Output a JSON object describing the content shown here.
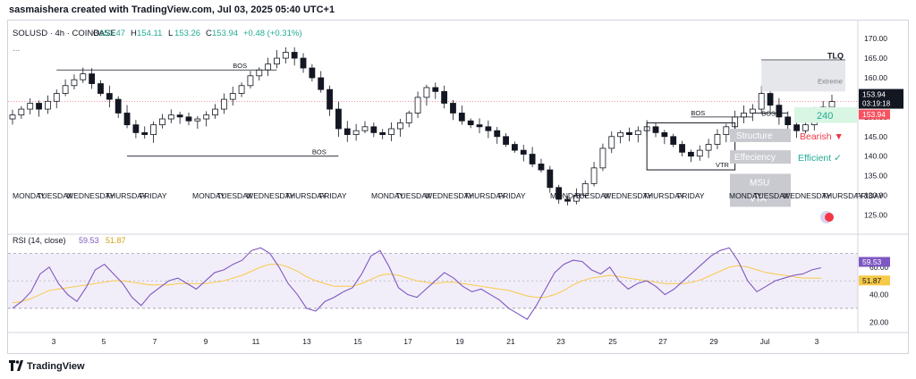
{
  "header": {
    "text": "sasmaishera created with TradingView.com, Jul 03, 2025 05:40 UTC+1"
  },
  "footer": {
    "brand": "TradingView"
  },
  "chart_data": [
    {
      "type": "candlestick",
      "symbol": "SOLUSD",
      "interval": "4h",
      "exchange": "COINBASE",
      "ohlc_labels": {
        "o": "O",
        "h": "H",
        "l": "L",
        "c": "C"
      },
      "ohlc": {
        "open": "153.47",
        "high": "154.11",
        "low": "153.26",
        "close": "153.94",
        "change": "+0.48 (+0.31%)"
      },
      "y_ticks": [
        170,
        165,
        160,
        155,
        150,
        145,
        140,
        135,
        130,
        125
      ],
      "ylim": [
        121,
        173
      ],
      "last_price": "153.94",
      "countdown": "03:19:18",
      "price_badge_2": "153.94",
      "x_ticks": [
        "3",
        "5",
        "7",
        "9",
        "11",
        "13",
        "15",
        "17",
        "19",
        "21",
        "23",
        "25",
        "27",
        "29",
        "Jul",
        "3"
      ],
      "close_path": [
        [
          0,
          150.5
        ],
        [
          1,
          152.0
        ],
        [
          2,
          153.5
        ],
        [
          3,
          152.0
        ],
        [
          4,
          154.0
        ],
        [
          5,
          156.0
        ],
        [
          6,
          158.0
        ],
        [
          7,
          159.5
        ],
        [
          8,
          161.0
        ],
        [
          9,
          158.5
        ],
        [
          10,
          156.0
        ],
        [
          11,
          154.5
        ],
        [
          12,
          151.0
        ],
        [
          13,
          148.0
        ],
        [
          14,
          146.0
        ],
        [
          15,
          145.5
        ],
        [
          16,
          148.0
        ],
        [
          17,
          149.5
        ],
        [
          18,
          150.5
        ],
        [
          19,
          150.0
        ],
        [
          20,
          149.0
        ],
        [
          21,
          149.5
        ],
        [
          22,
          150.5
        ],
        [
          23,
          152.0
        ],
        [
          24,
          154.5
        ],
        [
          25,
          156.0
        ],
        [
          26,
          158.0
        ],
        [
          27,
          160.5
        ],
        [
          28,
          162.0
        ],
        [
          29,
          163.5
        ],
        [
          30,
          165.0
        ],
        [
          31,
          166.5
        ],
        [
          32,
          165.0
        ],
        [
          33,
          162.5
        ],
        [
          34,
          160.0
        ],
        [
          35,
          157.0
        ],
        [
          36,
          152.0
        ],
        [
          37,
          147.0
        ],
        [
          38,
          145.5
        ],
        [
          39,
          146.5
        ],
        [
          40,
          147.5
        ],
        [
          41,
          146.0
        ],
        [
          42,
          145.5
        ],
        [
          43,
          147.0
        ],
        [
          44,
          148.5
        ],
        [
          45,
          151.0
        ],
        [
          46,
          155.0
        ],
        [
          47,
          157.5
        ],
        [
          48,
          156.5
        ],
        [
          49,
          153.5
        ],
        [
          50,
          151.0
        ],
        [
          51,
          149.0
        ],
        [
          52,
          148.0
        ],
        [
          53,
          147.5
        ],
        [
          54,
          146.5
        ],
        [
          55,
          145.0
        ],
        [
          56,
          143.0
        ],
        [
          57,
          141.5
        ],
        [
          58,
          140.5
        ],
        [
          59,
          138.0
        ],
        [
          60,
          136.5
        ],
        [
          61,
          132.0
        ],
        [
          62,
          129.0
        ],
        [
          63,
          128.5
        ],
        [
          64,
          130.0
        ],
        [
          65,
          133.0
        ],
        [
          66,
          137.0
        ],
        [
          67,
          142.0
        ],
        [
          68,
          145.0
        ],
        [
          69,
          146.0
        ],
        [
          70,
          145.5
        ],
        [
          71,
          146.5
        ],
        [
          72,
          147.5
        ],
        [
          73,
          146.0
        ],
        [
          74,
          145.0
        ],
        [
          75,
          143.0
        ],
        [
          76,
          141.0
        ],
        [
          77,
          140.0
        ],
        [
          78,
          141.5
        ],
        [
          79,
          143.0
        ],
        [
          80,
          145.5
        ],
        [
          81,
          147.5
        ],
        [
          82,
          150.0
        ],
        [
          83,
          151.0
        ],
        [
          84,
          152.0
        ],
        [
          85,
          156.0
        ],
        [
          86,
          153.0
        ],
        [
          87,
          150.0
        ],
        [
          88,
          148.0
        ],
        [
          89,
          146.5
        ],
        [
          90,
          148.0
        ],
        [
          91,
          150.5
        ],
        [
          92,
          152.5
        ],
        [
          93,
          153.94
        ]
      ],
      "annotations": {
        "bos_labels": [
          "BOS",
          "BOS",
          "BOS",
          "BOS"
        ],
        "vtr": "VTR",
        "tlq": "TLQ",
        "extreme": "Extreme",
        "price_240": "240",
        "structure": "Structure",
        "efficiency": "Effeciency",
        "msu": "MSU",
        "vta": "VTA",
        "bearish": "Bearish ▼",
        "efficient": "Efficient ✓",
        "bearish_color": "#f23645",
        "efficient_color": "#22ab94",
        "dots": "..."
      },
      "weekday_labels": [
        "MONDAY",
        "TUESDAY",
        "WEDNESDAY",
        "THURSDAY",
        "FRIDAY"
      ]
    },
    {
      "type": "line",
      "title": "RSI (14, close)",
      "series": [
        {
          "name": "RSI",
          "value_label": "59.53",
          "color": "#7e57c2"
        },
        {
          "name": "RSI MA",
          "value_label": "51.87",
          "color": "#f7c948"
        }
      ],
      "y_ticks": [
        60,
        40,
        20
      ],
      "band": [
        30,
        70
      ],
      "ylim": [
        15,
        80
      ],
      "rsi_values": [
        30,
        35,
        42,
        55,
        60,
        48,
        40,
        35,
        45,
        58,
        62,
        55,
        48,
        38,
        32,
        40,
        45,
        50,
        52,
        48,
        44,
        50,
        56,
        58,
        62,
        65,
        72,
        74,
        70,
        60,
        48,
        40,
        30,
        28,
        35,
        38,
        42,
        45,
        55,
        68,
        72,
        60,
        45,
        40,
        38,
        44,
        50,
        56,
        52,
        46,
        42,
        44,
        40,
        36,
        30,
        26,
        22,
        32,
        44,
        56,
        62,
        65,
        64,
        58,
        55,
        60,
        50,
        44,
        48,
        50,
        46,
        40,
        44,
        50,
        56,
        62,
        68,
        72,
        74,
        64,
        50,
        42,
        46,
        50,
        52,
        54,
        55,
        58,
        59.53
      ],
      "ma_values": [
        34,
        35,
        37,
        40,
        43,
        44,
        45,
        46,
        47,
        48,
        49,
        50,
        50,
        49,
        48,
        47,
        47,
        47,
        48,
        48,
        48,
        48,
        49,
        50,
        52,
        54,
        57,
        60,
        62,
        62,
        60,
        57,
        53,
        50,
        48,
        46,
        46,
        46,
        48,
        51,
        54,
        55,
        54,
        52,
        50,
        49,
        48,
        49,
        49,
        48,
        47,
        46,
        45,
        44,
        43,
        41,
        39,
        38,
        38,
        40,
        43,
        47,
        50,
        52,
        53,
        54,
        53,
        52,
        51,
        50,
        49,
        48,
        48,
        48,
        49,
        51,
        54,
        57,
        60,
        61,
        60,
        58,
        56,
        55,
        54,
        53,
        52,
        52,
        51.87
      ]
    }
  ]
}
